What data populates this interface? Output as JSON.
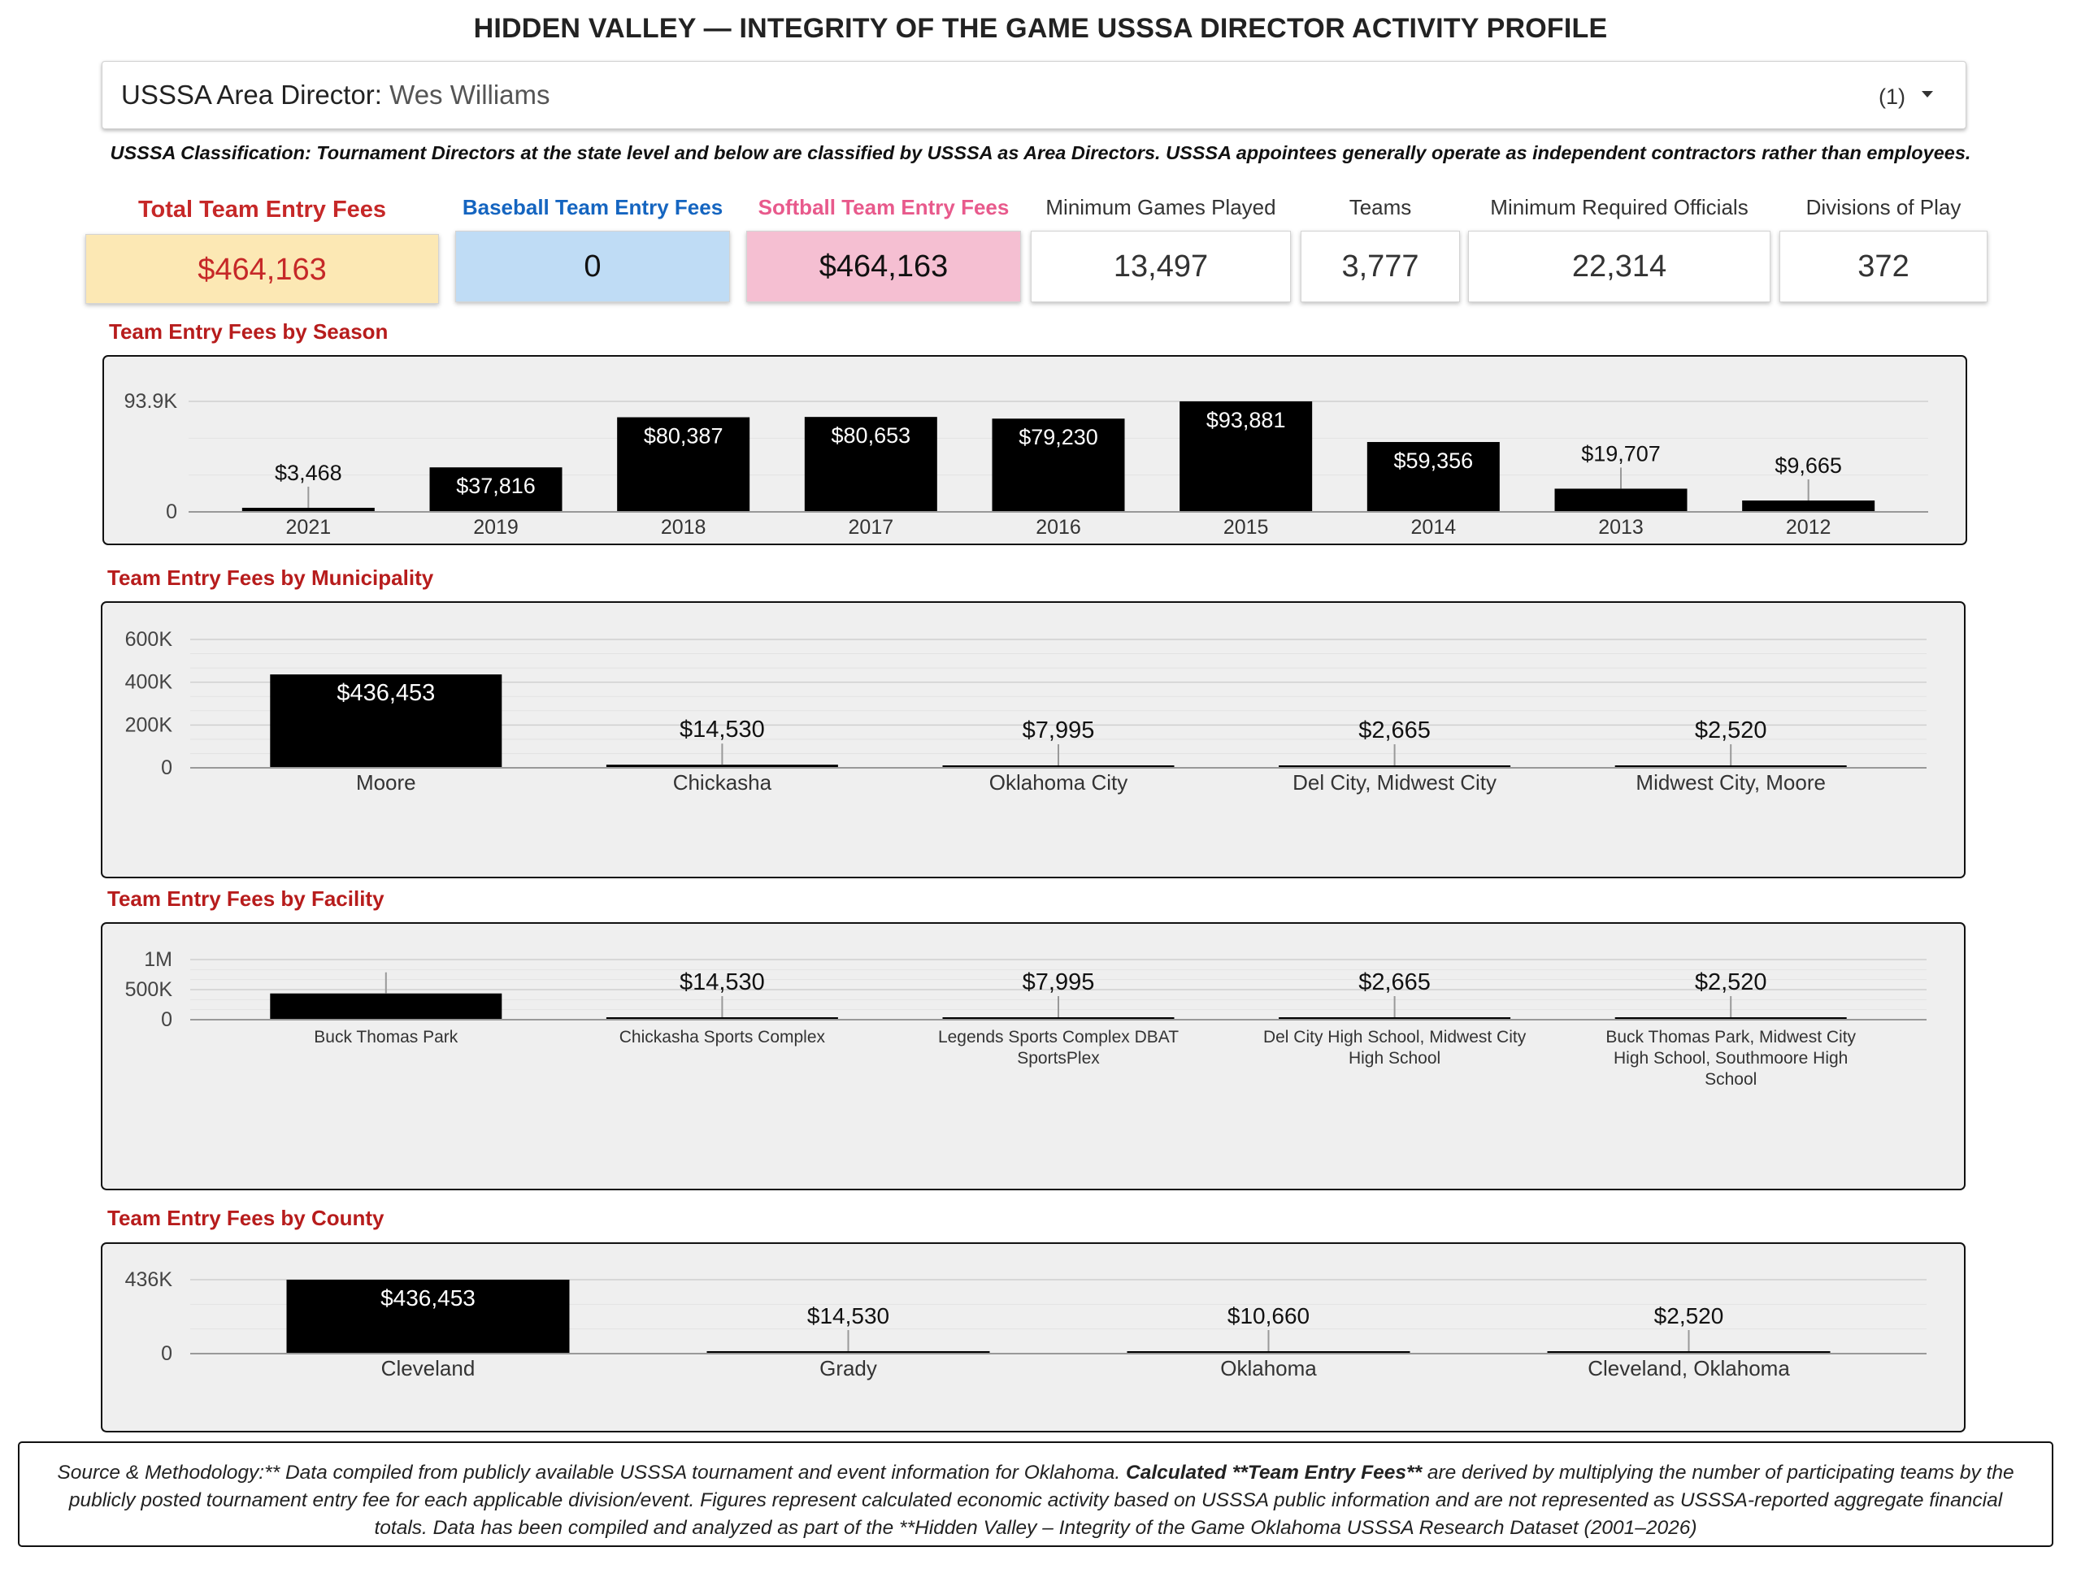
{
  "header": {
    "title": "HIDDEN VALLEY — INTEGRITY OF THE GAME USSSA DIRECTOR ACTIVITY PROFILE"
  },
  "director_select": {
    "label": "USSSA Area Director:",
    "value": "Wes Williams",
    "count": "(1)"
  },
  "classification_note": "USSSA Classification: Tournament Directors at the state level and below are classified by USSSA as Area Directors. USSSA appointees generally operate as independent contractors rather than employees.",
  "kpis": [
    {
      "label": "Total Team Entry Fees",
      "value": "$464,163",
      "label_color": "#c62828",
      "value_color": "#c62828",
      "bg": "#fce8b4"
    },
    {
      "label": "Baseball Team Entry Fees",
      "value": "0",
      "label_color": "#1565c0",
      "value_color": "#111111",
      "bg": "#bfdcf5"
    },
    {
      "label": "Softball Team Entry Fees",
      "value": "$464,163",
      "label_color": "#e85a8c",
      "value_color": "#111111",
      "bg": "#f5bfd2"
    },
    {
      "label": "Minimum Games Played",
      "value": "13,497",
      "label_color": "#333333",
      "value_color": "#333333",
      "bg": "#ffffff"
    },
    {
      "label": "Teams",
      "value": "3,777",
      "label_color": "#333333",
      "value_color": "#333333",
      "bg": "#ffffff"
    },
    {
      "label": "Minimum Required Officials",
      "value": "22,314",
      "label_color": "#333333",
      "value_color": "#333333",
      "bg": "#ffffff"
    },
    {
      "label": "Divisions of Play",
      "value": "372",
      "label_color": "#333333",
      "value_color": "#333333",
      "bg": "#ffffff"
    }
  ],
  "chart_data": [
    {
      "type": "bar",
      "title": "Team Entry Fees by Season",
      "categories": [
        "2021",
        "2019",
        "2018",
        "2017",
        "2016",
        "2015",
        "2014",
        "2013",
        "2012"
      ],
      "values": [
        3468,
        37816,
        80387,
        80653,
        79230,
        93881,
        59356,
        19707,
        9665
      ],
      "labels": [
        "$3,468",
        "$37,816",
        "$80,387",
        "$80,653",
        "$79,230",
        "$93,881",
        "$59,356",
        "$19,707",
        "$9,665"
      ],
      "yticks": [
        "0",
        "93.9K"
      ],
      "ylim": [
        0,
        93881
      ],
      "grid": true,
      "bar_color": "#000000"
    },
    {
      "type": "bar",
      "title": "Team Entry Fees by Municipality",
      "categories": [
        "Moore",
        "Chickasha",
        "Oklahoma City",
        "Del City, Midwest City",
        "Midwest City, Moore"
      ],
      "values": [
        436453,
        14530,
        7995,
        2665,
        2520
      ],
      "labels": [
        "$436,453",
        "$14,530",
        "$7,995",
        "$2,665",
        "$2,520"
      ],
      "yticks": [
        "0",
        "200K",
        "400K",
        "600K"
      ],
      "ylim": [
        0,
        600000
      ],
      "grid": true,
      "bar_color": "#000000"
    },
    {
      "type": "bar",
      "title": "Team Entry Fees by Facility",
      "categories": [
        "Buck Thomas Park",
        "Chickasha Sports Complex",
        "Legends Sports Complex DBAT SportsPlex",
        "Del City High School, Midwest City High School",
        "Buck Thomas Park, Midwest City High School, Southmoore High School"
      ],
      "values": [
        436453,
        14530,
        7995,
        2665,
        2520
      ],
      "labels": [
        "",
        "$14,530",
        "$7,995",
        "$2,665",
        "$2,520"
      ],
      "yticks": [
        "0",
        "500K",
        "1M"
      ],
      "ylim": [
        0,
        1000000
      ],
      "grid": true,
      "bar_color": "#000000"
    },
    {
      "type": "bar",
      "title": "Team Entry Fees by County",
      "categories": [
        "Cleveland",
        "Grady",
        "Oklahoma",
        "Cleveland, Oklahoma"
      ],
      "values": [
        436453,
        14530,
        10660,
        2520
      ],
      "labels": [
        "$436,453",
        "$14,530",
        "$10,660",
        "$2,520"
      ],
      "yticks": [
        "0",
        "436K"
      ],
      "ylim": [
        0,
        436453
      ],
      "grid": true,
      "bar_color": "#000000"
    }
  ],
  "footer": {
    "text_1": "Source & Methodology:** Data compiled from publicly available USSSA tournament and event information for Oklahoma. ",
    "text_bold": "Calculated **Team Entry Fees**",
    "text_2": " are derived by multiplying the number of participating teams by the publicly posted tournament entry fee for each applicable division/event. Figures represent calculated economic activity based on USSSA public information and are not represented as USSSA-reported aggregate financial totals. Data has been compiled and analyzed as part of the **Hidden Valley – Integrity of the Game Oklahoma USSSA Research Dataset (2001–2026)"
  }
}
